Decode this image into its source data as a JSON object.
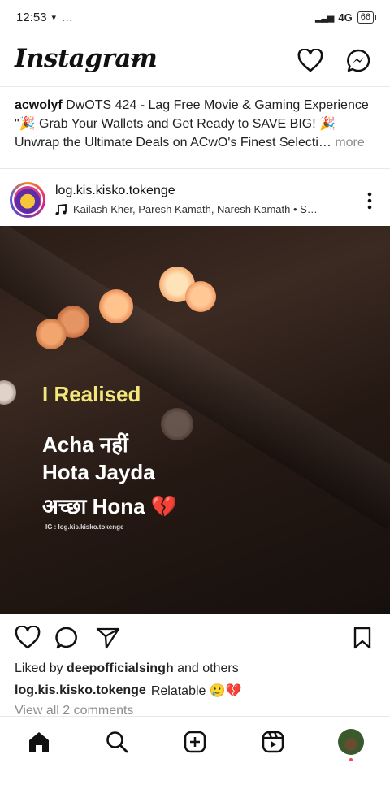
{
  "status_bar": {
    "time": "12:53",
    "extras": "…",
    "network": "4G",
    "battery": "66"
  },
  "header": {
    "app_name": "Instagram"
  },
  "sponsored": {
    "account": "acwolyf",
    "line1": "DwOTS 424 - Lag Free Movie & Gaming Experience",
    "line2": "\"🎉 Grab Your Wallets and Get Ready to SAVE BIG! 🎉",
    "line3": "Unwrap the Ultimate Deals on ACwO's Finest Selecti…",
    "more": "more"
  },
  "post": {
    "username": "log.kis.kisko.tokenge",
    "music": "Kailash Kher, Paresh Kamath, Naresh Kamath • S…",
    "image_text": {
      "line1": "I Realised",
      "line2": "Acha नहीं",
      "line3": "Hota Jayda",
      "line4": "अच्छा Hona 💔",
      "credit": "IG : log.kis.kisko.tokenge"
    },
    "liked_prefix": "Liked by",
    "liked_user": "deepofficialsingh",
    "liked_suffix": "and others",
    "caption_user": "log.kis.kisko.tokenge",
    "caption_text": "Relatable 🥲💔",
    "view_comments": "View all 2 comments"
  },
  "icons": {
    "wifi": "wifi-icon",
    "signal": "signal-icon",
    "heart": "heart-icon",
    "messenger": "messenger-icon",
    "like": "like-icon",
    "comment": "comment-icon",
    "share": "share-icon",
    "save": "bookmark-icon",
    "home": "home-icon",
    "search": "search-icon",
    "create": "create-icon",
    "reels": "reels-icon"
  }
}
